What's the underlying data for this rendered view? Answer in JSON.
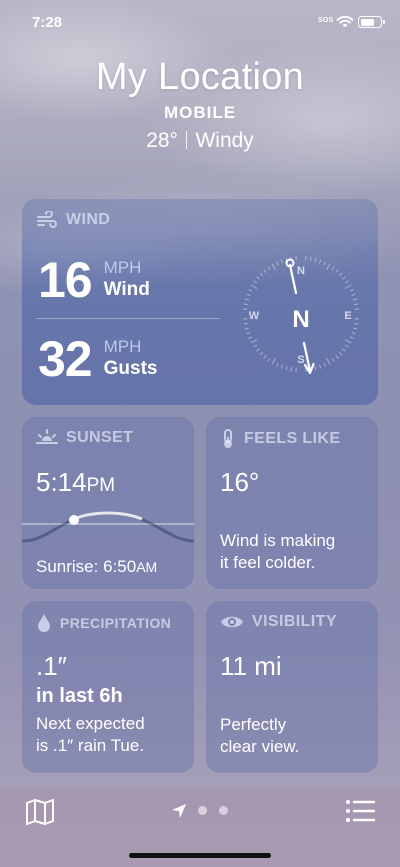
{
  "status": {
    "time": "7:28",
    "sos": "SOS"
  },
  "header": {
    "location": "My Location",
    "city": "MOBILE",
    "temp": "28°",
    "condition": "Windy"
  },
  "wind": {
    "title": "WIND",
    "speed": "16",
    "speed_unit": "MPH",
    "speed_label": "Wind",
    "gusts": "32",
    "gusts_unit": "MPH",
    "gusts_label": "Gusts",
    "compass": {
      "n": "N",
      "s": "S",
      "e": "E",
      "w": "W",
      "center": "N"
    }
  },
  "sunset": {
    "title": "SUNSET",
    "time": "5:14",
    "ampm": "PM",
    "sunrise_label": "Sunrise: 6:50",
    "sunrise_ampm": "AM"
  },
  "feels_like": {
    "title": "FEELS LIKE",
    "value": "16°",
    "desc_line1": "Wind is making",
    "desc_line2": "it feel colder."
  },
  "precipitation": {
    "title": "PRECIPITATION",
    "amount": ".1″",
    "period": "in last 6h",
    "desc_line1": "Next expected",
    "desc_line2": "is .1″ rain Tue."
  },
  "visibility": {
    "title": "VISIBILITY",
    "value": "11 mi",
    "desc_line1": "Perfectly",
    "desc_line2": "clear view."
  },
  "tab_bar": {
    "icons": [
      "map-icon",
      "location-arrow-icon",
      "page-dot",
      "page-dot",
      "list-icon"
    ]
  }
}
